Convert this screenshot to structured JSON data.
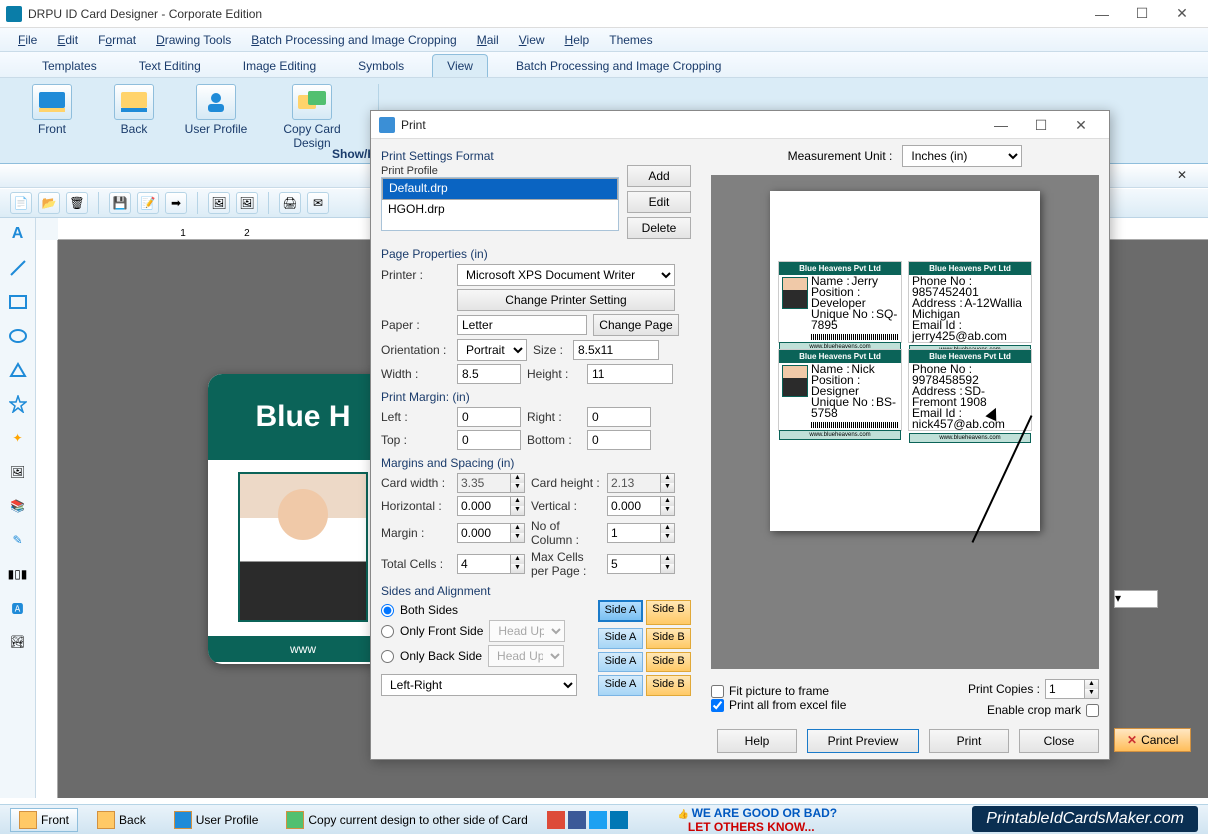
{
  "app": {
    "title": "DRPU ID Card Designer - Corporate Edition"
  },
  "menus": [
    "File",
    "Edit",
    "Format",
    "Drawing Tools",
    "Batch Processing and Image Cropping",
    "Mail",
    "View",
    "Help",
    "Themes"
  ],
  "ribbonTabs": [
    "Templates",
    "Text Editing",
    "Image Editing",
    "Symbols",
    "View",
    "Batch Processing and Image Cropping"
  ],
  "ribbon": {
    "front": "Front",
    "back": "Back",
    "userProfile": "User Profile",
    "copyDesign": "Copy Card Design",
    "showHide": "Show/H"
  },
  "card": {
    "title": "Blue H",
    "footer": "www"
  },
  "dialog": {
    "title": "Print",
    "settingsFormat": "Print Settings Format",
    "printProfile": "Print Profile",
    "profiles": [
      "Default.drp",
      "HGOH.drp"
    ],
    "add": "Add",
    "edit": "Edit",
    "delete": "Delete",
    "pageProps": "Page Properties (in)",
    "printer": "Printer :",
    "printerVal": "Microsoft XPS Document Writer",
    "changePrinter": "Change Printer Setting",
    "paper": "Paper :",
    "paperVal": "Letter",
    "changePage": "Change Page",
    "orientation": "Orientation :",
    "orientationVal": "Portrait",
    "size": "Size :",
    "sizeVal": "8.5x11",
    "width": "Width :",
    "widthVal": "8.5",
    "height": "Height :",
    "heightVal": "11",
    "printMargin": "Print Margin: (in)",
    "left": "Left :",
    "leftVal": "0",
    "right": "Right :",
    "rightVal": "0",
    "top": "Top :",
    "topVal": "0",
    "bottom": "Bottom :",
    "bottomVal": "0",
    "marginsSpacing": "Margins and Spacing (in)",
    "cardWidth": "Card width :",
    "cardWidthVal": "3.35",
    "cardHeight": "Card height :",
    "cardHeightVal": "2.13",
    "horizontal": "Horizontal :",
    "horizontalVal": "0.000",
    "vertical": "Vertical :",
    "verticalVal": "0.000",
    "margin": "Margin :",
    "marginVal": "0.000",
    "noCol": "No of Column :",
    "noColVal": "1",
    "totalCells": "Total Cells :",
    "totalCellsVal": "4",
    "maxCells": "Max Cells per Page :",
    "maxCellsVal": "5",
    "sidesAlign": "Sides and Alignment",
    "both": "Both Sides",
    "onlyFront": "Only Front Side",
    "onlyBack": "Only Back Side",
    "headUp": "Head Up",
    "leftRight": "Left-Right",
    "sideA": "Side A",
    "sideB": "Side B",
    "measurementUnit": "Measurement Unit :",
    "measurementVal": "Inches (in)",
    "fitPicture": "Fit picture to frame",
    "printExcel": "Print all from excel file",
    "printCopies": "Print Copies :",
    "copiesVal": "1",
    "enableCrop": "Enable crop mark",
    "help": "Help",
    "printPreview": "Print Preview",
    "print": "Print",
    "close": "Close",
    "preview": {
      "company": "Blue Heavens Pvt Ltd",
      "website": "www.blueheavens.com",
      "cards": [
        {
          "name": "Name :",
          "nameVal": "Jerry",
          "pos": "Position :",
          "posVal": "Developer",
          "uid": "Unique No :",
          "uidVal": "SQ-7895"
        },
        {
          "phone": "Phone No :",
          "phoneVal": "9857452401",
          "addr": "Address :",
          "addrVal": "A-12Wallia Michigan",
          "email": "Email Id :",
          "emailVal": "jerry425@ab.com"
        },
        {
          "name": "Name :",
          "nameVal": "Nick",
          "pos": "Position :",
          "posVal": "Designer",
          "uid": "Unique No :",
          "uidVal": "BS-5758"
        },
        {
          "phone": "Phone No :",
          "phoneVal": "9978458592",
          "addr": "Address :",
          "addrVal": "SD-Fremont 1908",
          "email": "Email Id :",
          "emailVal": "nick457@ab.com"
        }
      ]
    }
  },
  "cancel": "Cancel",
  "status": {
    "front": "Front",
    "back": "Back",
    "userProfile": "User Profile",
    "copyDesign": "Copy current design to other side of Card",
    "good": "WE ARE GOOD OR BAD?",
    "others": "LET OTHERS KNOW..."
  },
  "watermark": "PrintableIdCardsMaker.com"
}
